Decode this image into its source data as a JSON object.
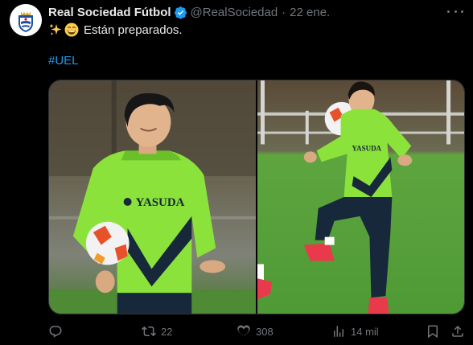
{
  "tweet": {
    "author": {
      "display_name": "Real Sociedad Fútbol",
      "handle": "@RealSociedad",
      "verified": true
    },
    "separator": "·",
    "date": "22 ene.",
    "emojis": [
      "sparkles-emoji",
      "grinning-face-emoji"
    ],
    "text": "Están preparados.",
    "hashtag": "#UEL",
    "media": [
      {
        "name": "player-holding-ball-photo",
        "shirt_text": "YASUDA"
      },
      {
        "name": "player-juggling-ball-photo",
        "shirt_text": "YASUDA"
      }
    ],
    "stats": {
      "replies": "",
      "retweets": "22",
      "likes": "308",
      "views": "14 mil"
    }
  },
  "colors": {
    "background": "#000000",
    "text_primary": "#e7e9ea",
    "text_secondary": "#71767b",
    "link": "#1d9bf0",
    "verified_badge": "#1d9bf0",
    "jersey_green": "#8be23a"
  }
}
